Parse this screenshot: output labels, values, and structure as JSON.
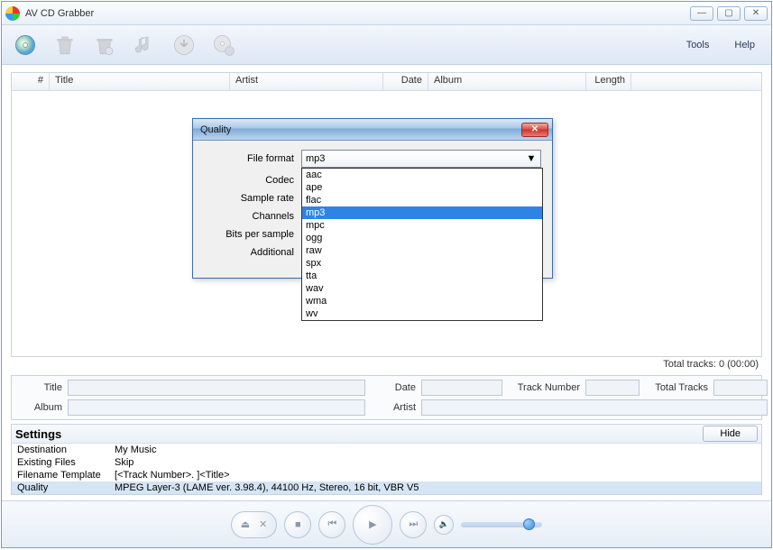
{
  "app": {
    "title": "AV CD Grabber"
  },
  "menu": {
    "tools": "Tools",
    "help": "Help"
  },
  "columns": {
    "num": "#",
    "title": "Title",
    "artist": "Artist",
    "date": "Date",
    "album": "Album",
    "length": "Length"
  },
  "totals": {
    "label": "Total tracks: 0 (00:00)"
  },
  "meta": {
    "title_label": "Title",
    "title_value": "",
    "date_label": "Date",
    "date_value": "",
    "tracknum_label": "Track Number",
    "tracknum_value": "",
    "totaltracks_label": "Total Tracks",
    "totaltracks_value": "",
    "album_label": "Album",
    "album_value": "",
    "artist_label": "Artist",
    "artist_value": ""
  },
  "settings": {
    "heading": "Settings",
    "hide": "Hide",
    "rows": {
      "dest_label": "Destination",
      "dest_value": "My Music",
      "existing_label": "Existing Files",
      "existing_value": "Skip",
      "template_label": "Filename Template",
      "template_value": "[<Track Number>. ]<Title>",
      "quality_label": "Quality",
      "quality_value": "MPEG Layer-3 (LAME ver. 3.98.4), 44100 Hz, Stereo, 16 bit, VBR V5"
    }
  },
  "dialog": {
    "title": "Quality",
    "labels": {
      "file_format": "File format",
      "codec": "Codec",
      "sample_rate": "Sample rate",
      "channels": "Channels",
      "bits": "Bits per sample",
      "additional": "Additional"
    },
    "file_format_value": "mp3",
    "options": [
      "aac",
      "ape",
      "flac",
      "mp3",
      "mpc",
      "ogg",
      "raw",
      "spx",
      "tta",
      "wav",
      "wma",
      "wv"
    ],
    "selected": "mp3"
  }
}
